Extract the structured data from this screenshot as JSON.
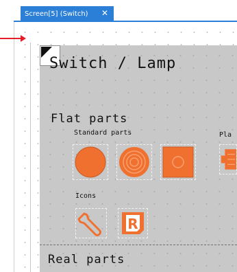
{
  "tab": {
    "title": "Screen[5] (Switch)",
    "close": "✕"
  },
  "screen": {
    "title": "Switch / Lamp",
    "flat_heading": "Flat parts",
    "standard_label": "Standard parts",
    "plates_label": "Pla",
    "icons_label": "Icons",
    "real_heading": "Real parts"
  },
  "colors": {
    "accent": "#f07030",
    "tab_blue": "#2b7fd6",
    "marker": "#e3202a",
    "screen_bg": "#c8c8c8"
  },
  "icons": [
    "circle-lamp-icon",
    "ring-lamp-icon",
    "square-switch-icon",
    "plate-switch-icon",
    "wrench-icon",
    "r-badge-icon"
  ]
}
